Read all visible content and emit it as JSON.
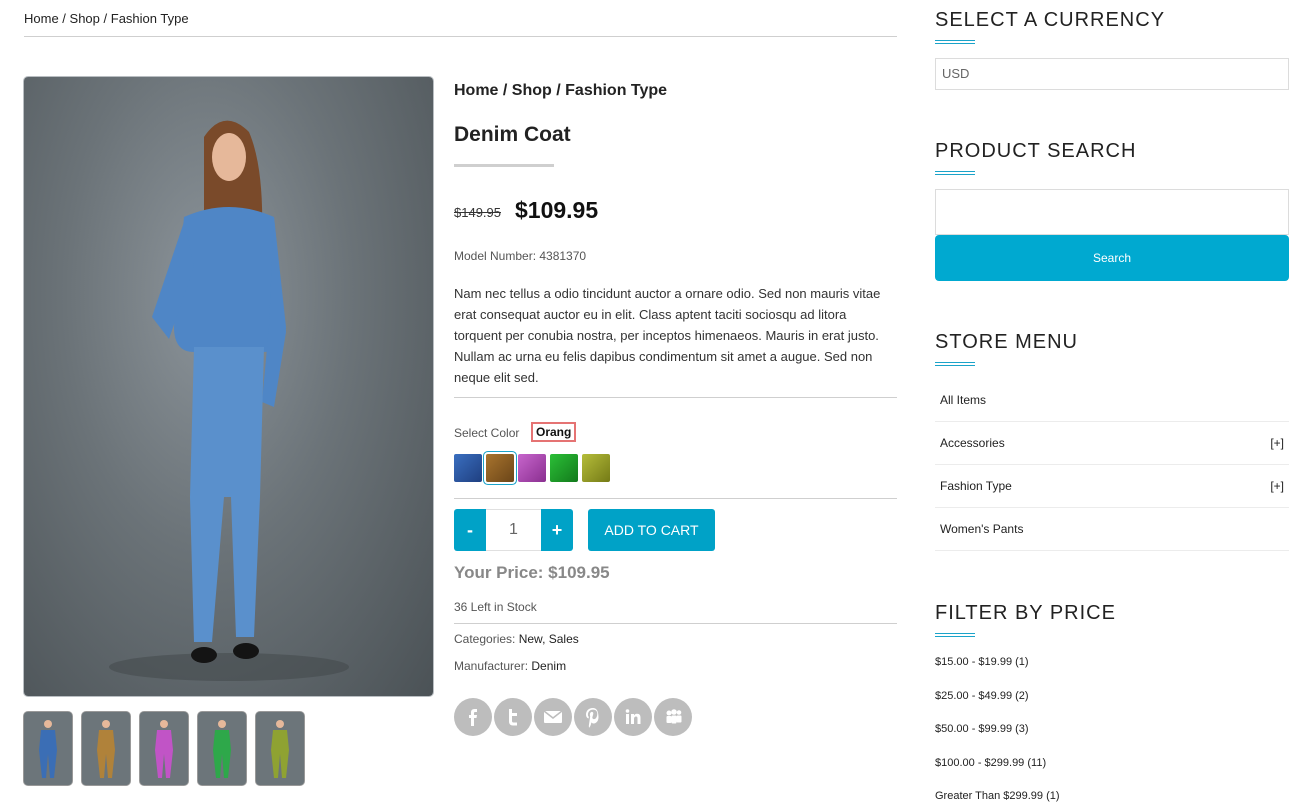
{
  "breadcrumb": {
    "home": "Home",
    "shop": "Shop",
    "category": "Fashion Type",
    "sep": " / "
  },
  "product": {
    "title": "Denim Coat",
    "old_price": "$149.95",
    "price": "$109.95",
    "model_number": "Model Number: 4381370",
    "description": "Nam nec tellus a odio tincidunt auctor a ornare odio. Sed non mauris vitae erat consequat auctor eu in elit. Class aptent taciti sociosqu ad litora torquent per conubia nostra, per inceptos himenaeos. Mauris in erat justo. Nullam ac urna eu felis dapibus condimentum sit amet a augue. Sed non neque elit sed.",
    "select_color_label": "Select Color",
    "selected_color": "Orang",
    "swatches": [
      "#2c56a0",
      "#8a5a24",
      "#b04ab5",
      "#1f9a2a",
      "#9aa22a"
    ],
    "quantity": "1",
    "minus_label": "-",
    "plus_label": "+",
    "add_to_cart": "ADD TO CART",
    "your_price": "Your Price: $109.95",
    "stock": "36 Left in Stock",
    "categories_label": "Categories:",
    "categories_value": "New, Sales",
    "manufacturer_label": "Manufacturer:",
    "manufacturer_value": "Denim",
    "thumb_colors": [
      "#3b6eb5",
      "#b0823a",
      "#c154c6",
      "#2ea84a",
      "#8fa232"
    ],
    "social_icons": [
      "facebook-icon",
      "twitter-icon",
      "email-icon",
      "pinterest-icon",
      "linkedin-icon",
      "myspace-icon"
    ]
  },
  "sidebar": {
    "currency_title": "SELECT A CURRENCY",
    "currency_value": "USD",
    "search_title": "PRODUCT SEARCH",
    "search_button": "Search",
    "menu_title": "STORE MENU",
    "menu_items": [
      {
        "label": "All Items",
        "expand": ""
      },
      {
        "label": "Accessories",
        "expand": "[+]"
      },
      {
        "label": "Fashion Type",
        "expand": "[+]"
      },
      {
        "label": "Women's Pants",
        "expand": ""
      }
    ],
    "filter_title": "FILTER BY PRICE",
    "price_filters": [
      "$15.00 - $19.99 (1)",
      "$25.00 - $49.99 (2)",
      "$50.00 - $99.99 (3)",
      "$100.00 - $299.99 (11)",
      "Greater Than $299.99 (1)"
    ]
  },
  "colors": {
    "accent": "#00a2c7"
  }
}
